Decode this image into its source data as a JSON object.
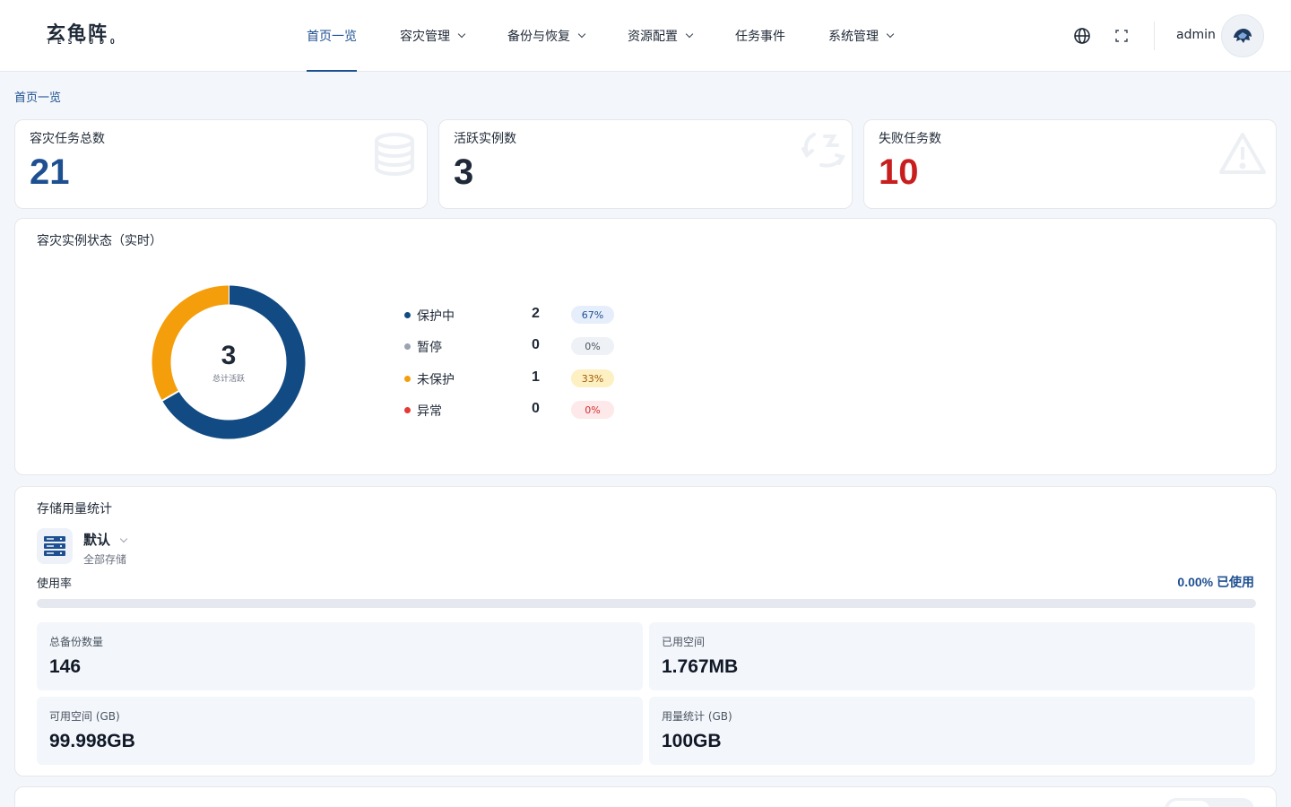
{
  "brand": {
    "logo_main": "玄龟阵",
    "logo_sub": "TESTUDO"
  },
  "nav": [
    {
      "label": "首页一览",
      "active": true,
      "dropdown": false
    },
    {
      "label": "容灾管理",
      "active": false,
      "dropdown": true
    },
    {
      "label": "备份与恢复",
      "active": false,
      "dropdown": true
    },
    {
      "label": "资源配置",
      "active": false,
      "dropdown": true
    },
    {
      "label": "任务事件",
      "active": false,
      "dropdown": false
    },
    {
      "label": "系统管理",
      "active": false,
      "dropdown": true
    }
  ],
  "topbar": {
    "icons": [
      "globe-icon",
      "fullscreen-icon"
    ],
    "username": "admin"
  },
  "breadcrumb": "首页一览",
  "stats": [
    {
      "label": "容灾任务总数",
      "value": "21",
      "color": "#1d4f91",
      "icon": "database-icon"
    },
    {
      "label": "活跃实例数",
      "value": "3",
      "color": "#1f2937",
      "icon": "sync-icon"
    },
    {
      "label": "失败任务数",
      "value": "10",
      "color": "#c81e1e",
      "icon": "warning-icon"
    }
  ],
  "instance_status": {
    "title": "容灾实例状态（实时）",
    "total": "3",
    "total_label": "总计活跃",
    "items": [
      {
        "label": "保护中",
        "count": 2,
        "percent": "67%",
        "color": "#124b83",
        "pill_bg": "#e6eefb",
        "pill_fg": "#1d4f91"
      },
      {
        "label": "暂停",
        "count": 0,
        "percent": "0%",
        "color": "#9ca3af",
        "pill_bg": "#eef1f5",
        "pill_fg": "#4b5563"
      },
      {
        "label": "未保护",
        "count": 1,
        "percent": "33%",
        "color": "#f59e0b",
        "pill_bg": "#fdf0c2",
        "pill_fg": "#a15c07"
      },
      {
        "label": "异常",
        "count": 0,
        "percent": "0%",
        "color": "#e53935",
        "pill_bg": "#fde8ea",
        "pill_fg": "#d32f2f"
      }
    ]
  },
  "storage": {
    "title": "存储用量统计",
    "selected_name": "默认",
    "selected_sub": "全部存储",
    "usage_label": "使用率",
    "usage_value": "0.00% 已使用",
    "usage_fraction": 0.0,
    "metrics": [
      {
        "label": "总备份数量",
        "value": "146"
      },
      {
        "label": "已用空间",
        "value": "1.767MB"
      },
      {
        "label": "可用空间 (GB)",
        "value": "99.998GB"
      },
      {
        "label": "用量统计 (GB)",
        "value": "100GB"
      }
    ]
  },
  "accent": "#1d4f91"
}
